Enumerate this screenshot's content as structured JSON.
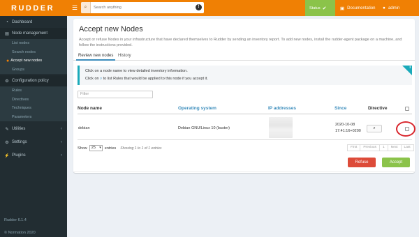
{
  "app": {
    "logo": "RUDDER",
    "version": "Rudder 6.1.4",
    "copyright": "© Normation 2020"
  },
  "sidebar": {
    "dashboard": "Dashboard",
    "node_management": "Node management",
    "node_items": [
      "List nodes",
      "Search nodes",
      "Accept new nodes",
      "Groups"
    ],
    "configuration_policy": "Configuration policy",
    "config_items": [
      "Rules",
      "Directives",
      "Techniques",
      "Parameters"
    ],
    "utilities": "Utilities",
    "settings": "Settings",
    "plugins": "Plugins"
  },
  "topbar": {
    "search_placeholder": "Search anything",
    "status": "Status",
    "documentation": "Documentation",
    "user": "admin"
  },
  "page": {
    "title": "Accept new Nodes",
    "description": "Accept or refuse Nodes in your infrastructure that have declared themselves to Rudder by sending an inventory report. To add new nodes, install the rudder-agent package on a machine, and follow the instructions provided.",
    "tabs": [
      "Review new nodes",
      "History"
    ],
    "callout_line1": "Click on a node name to view detailed inventory information.",
    "callout_line2_a": "Click on",
    "callout_line2_b": "to list Rules that would be applied to this node if you accept it.",
    "filter_placeholder": "Filter"
  },
  "table": {
    "headers": [
      "Node name",
      "Operating system",
      "IP addresses",
      "Since",
      "Directive"
    ],
    "rows": [
      {
        "name": "debian",
        "os": "Debian GNU/Linux 10 (buster)",
        "since_date": "2020-10-08",
        "since_time": "17:41:16+0200"
      }
    ]
  },
  "pagination": {
    "show_label": "Show",
    "page_size": "25",
    "entries_label": "entries",
    "info": "Showing 1 to 1 of 1 entries",
    "buttons": [
      "First",
      "Previous",
      "1",
      "Next",
      "Last"
    ]
  },
  "actions": {
    "refuse": "Refuse",
    "accept": "Accept"
  },
  "colors": {
    "brand": "#f08004",
    "sidebar": "#222d32",
    "link": "#3c8dbc",
    "accept": "#8bc34a",
    "refuse": "#dd4b39",
    "callout": "#1aaaba",
    "highlight": "#d9272e"
  },
  "icons": [
    "dashboard-icon",
    "sitemap-icon",
    "cogs-icon",
    "wrench-icon",
    "gear-icon",
    "plug-icon",
    "search-icon",
    "info-icon",
    "book-icon",
    "user-icon"
  ]
}
